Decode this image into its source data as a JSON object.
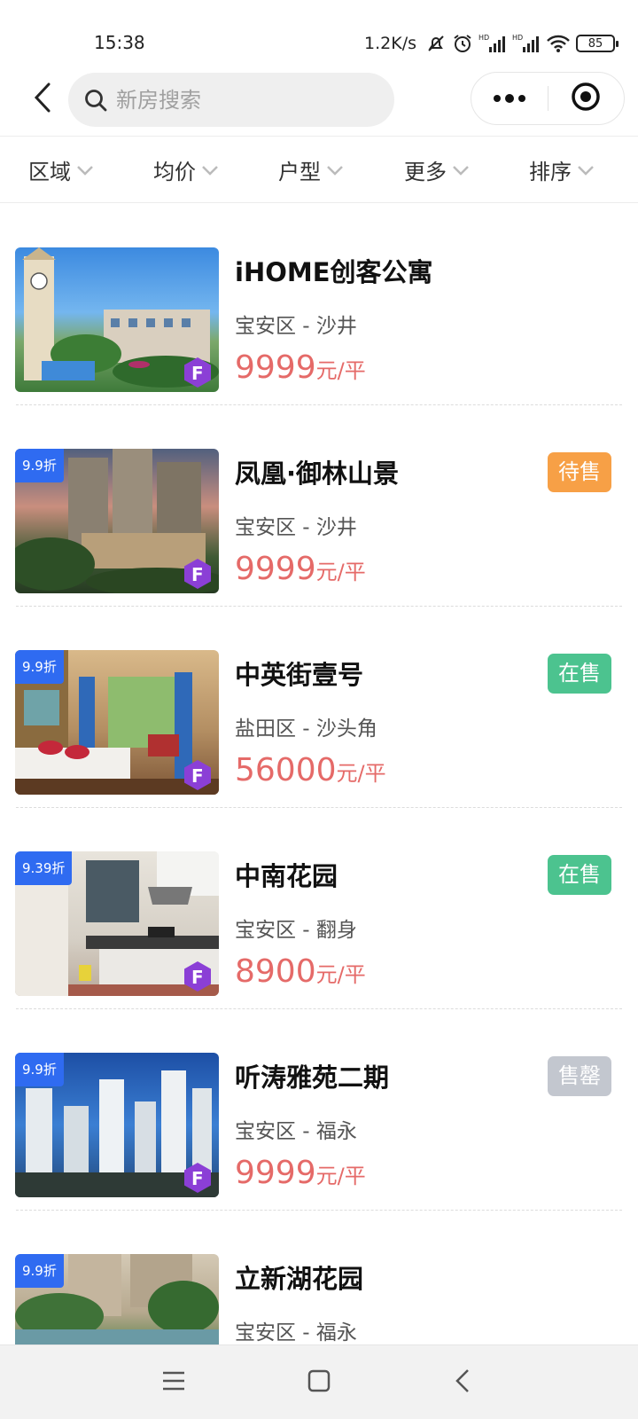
{
  "status_bar": {
    "time": "15:38",
    "net_speed": "1.2K/s",
    "battery": "85",
    "icons": [
      "mute-bell-icon",
      "alarm-icon",
      "hd-signal-icon",
      "hd-signal-icon",
      "wifi-icon",
      "battery-icon"
    ]
  },
  "header": {
    "back_icon": "chevron-left-icon",
    "search": {
      "placeholder": "新房搜索",
      "icon": "search-icon"
    },
    "capsule": {
      "more_icon": "more-dots-icon",
      "close_icon": "target-circle-icon"
    }
  },
  "filters": [
    {
      "label": "区域"
    },
    {
      "label": "均价"
    },
    {
      "label": "户型"
    },
    {
      "label": "更多"
    },
    {
      "label": "排序"
    }
  ],
  "listings": [
    {
      "name": "iHOME创客公寓",
      "area": "宝安区 - 沙井",
      "price": "9999",
      "unit": "元/平",
      "discount": "",
      "status": "",
      "status_color": ""
    },
    {
      "name": "凤凰·御林山景",
      "area": "宝安区 - 沙井",
      "price": "9999",
      "unit": "元/平",
      "discount": "9.9折",
      "status": "待售",
      "status_color": "#f7a046"
    },
    {
      "name": "中英街壹号",
      "area": "盐田区 - 沙头角",
      "price": "56000",
      "unit": "元/平",
      "discount": "9.9折",
      "status": "在售",
      "status_color": "#4cc38f"
    },
    {
      "name": "中南花园",
      "area": "宝安区 - 翻身",
      "price": "8900",
      "unit": "元/平",
      "discount": "9.39折",
      "status": "在售",
      "status_color": "#4cc38f"
    },
    {
      "name": "听涛雅苑二期",
      "area": "宝安区 - 福永",
      "price": "9999",
      "unit": "元/平",
      "discount": "9.9折",
      "status": "售罄",
      "status_color": "#c3c7cf"
    },
    {
      "name": "立新湖花园",
      "area": "宝安区 - 福永",
      "price": "",
      "unit": "",
      "discount": "9.9折",
      "status": "",
      "status_color": ""
    }
  ],
  "nav_bar": {
    "icons": [
      "menu-icon",
      "home-square-icon",
      "back-triangle-icon"
    ]
  },
  "colors": {
    "price": "#e56a68",
    "discount_bg": "#2f6bf1",
    "search_bg": "#efefef"
  }
}
